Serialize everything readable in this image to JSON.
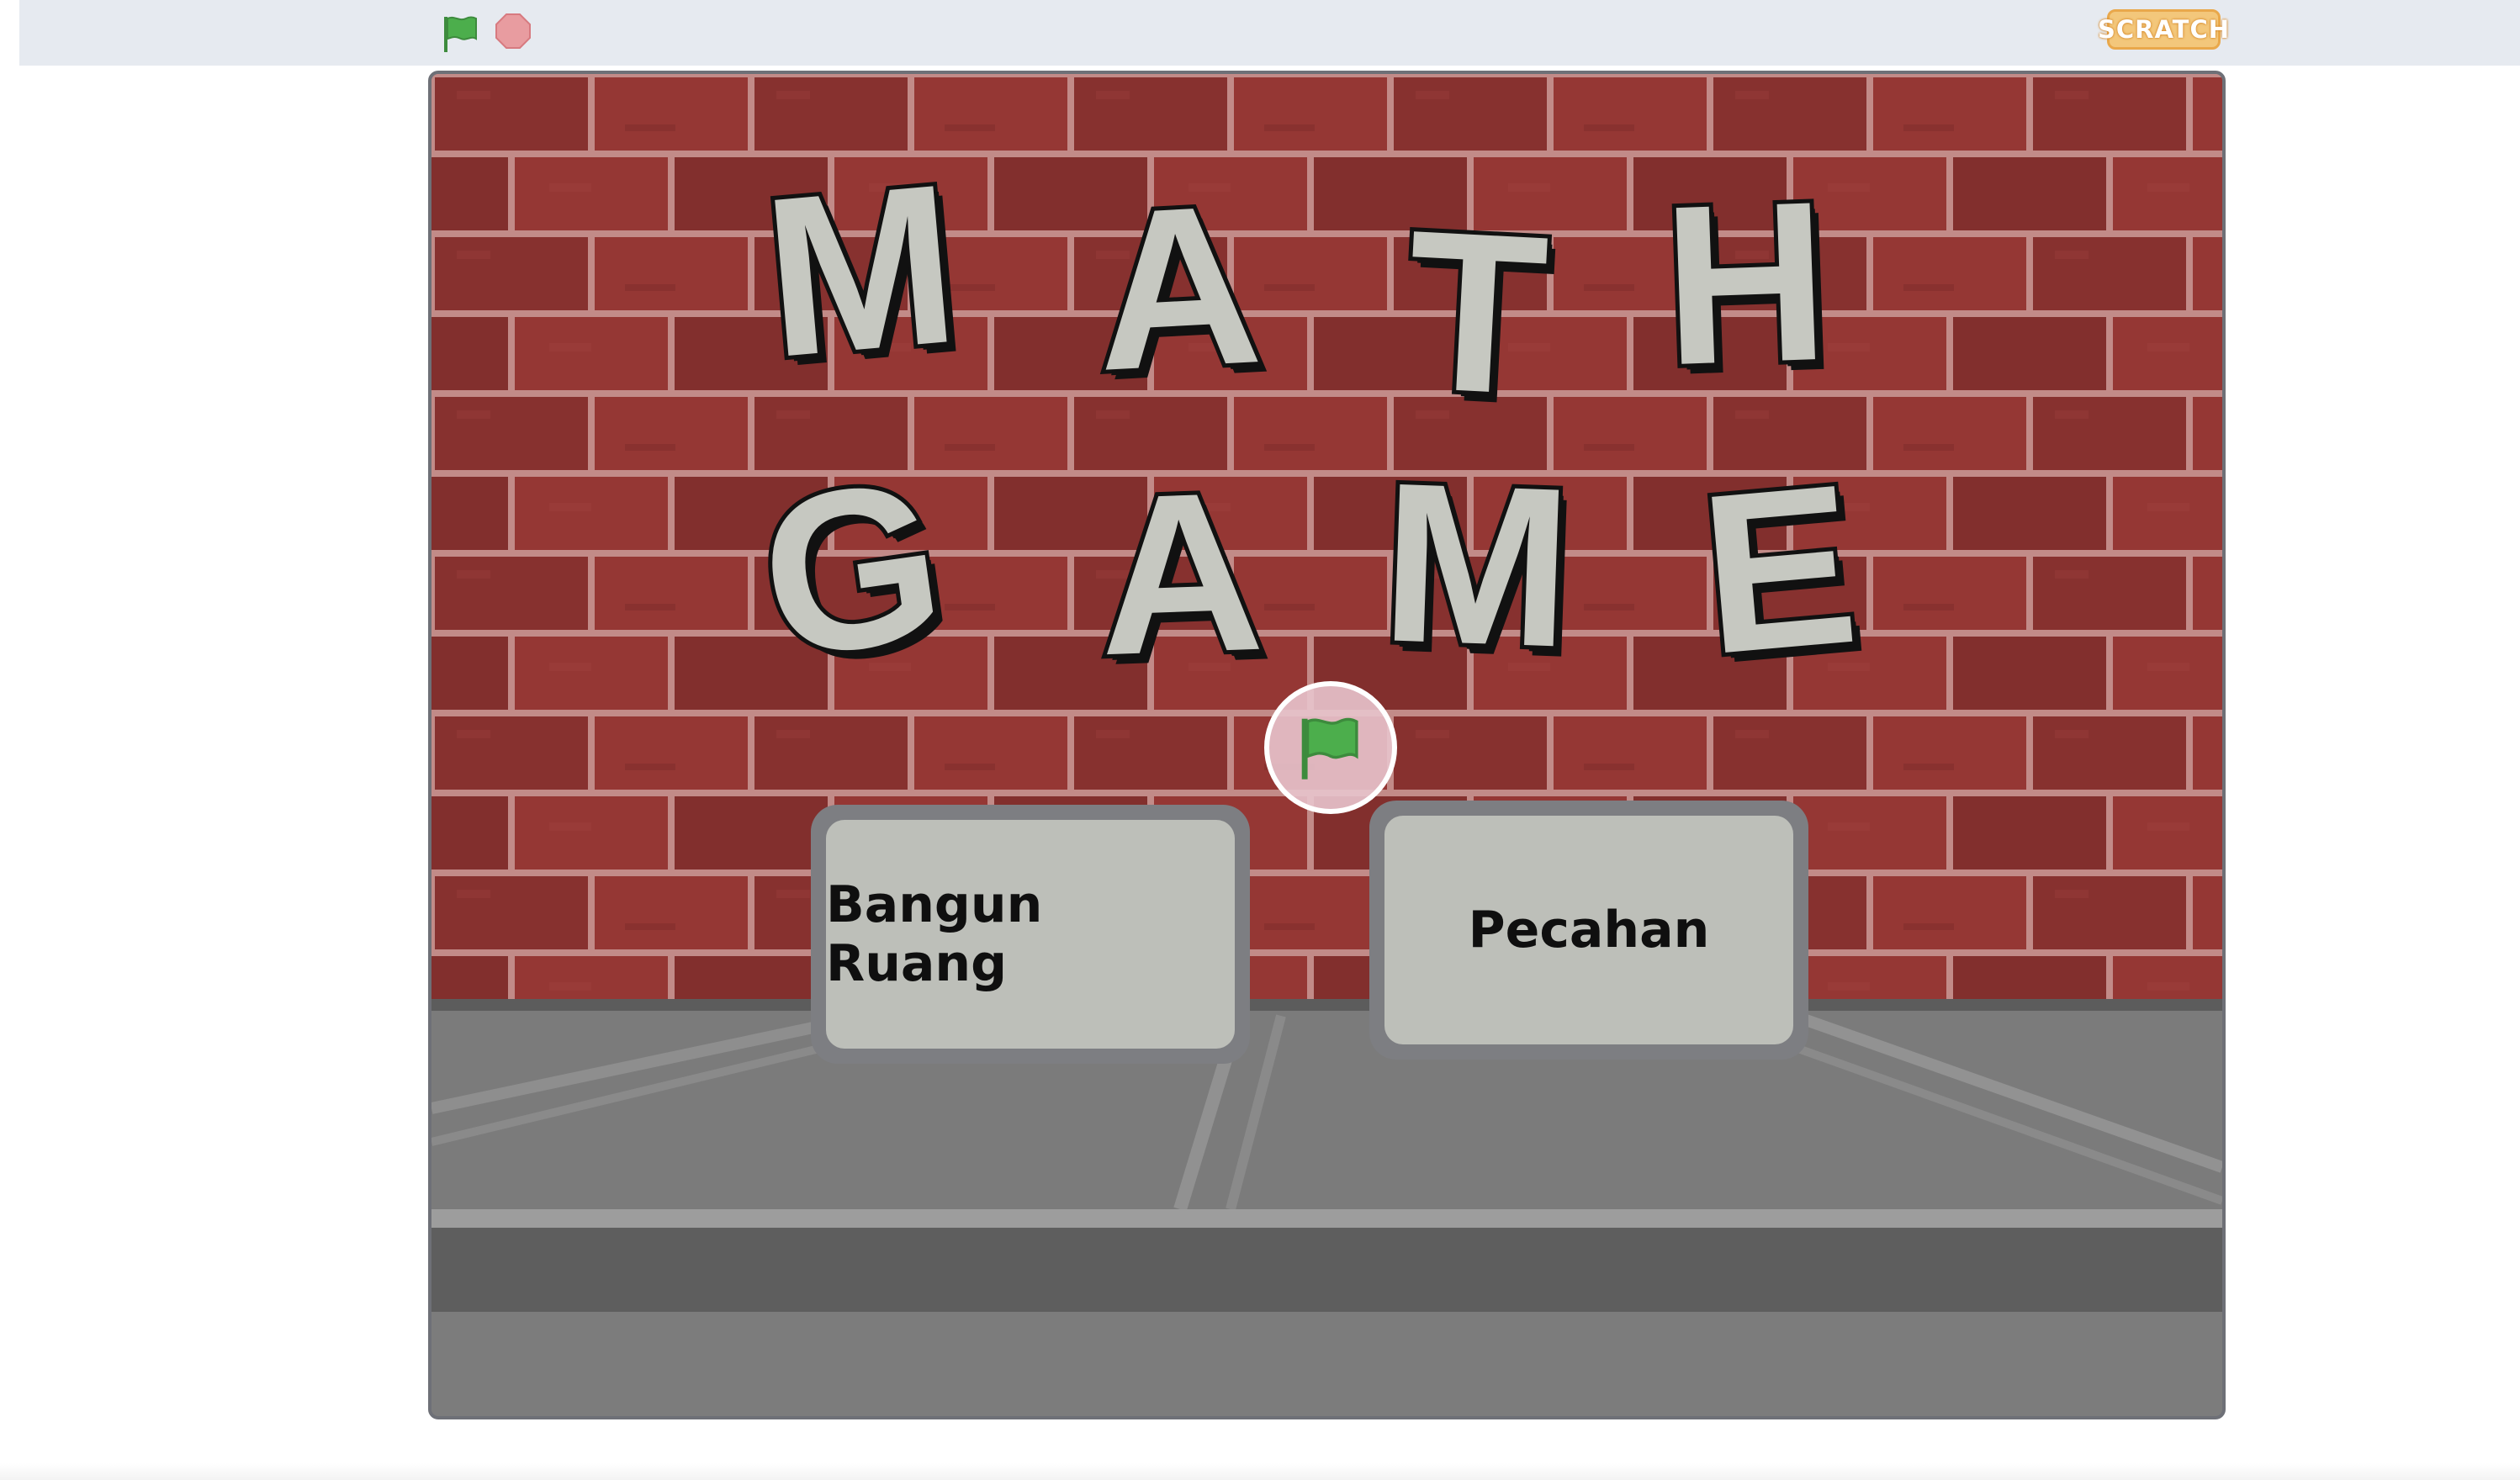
{
  "toolbar": {
    "green_flag_icon": "green-flag-icon",
    "stop_icon": "stop-sign-icon",
    "brand_logo_text": "SCRATCH"
  },
  "stage": {
    "title_line_1": [
      "M",
      "A",
      "T",
      "H"
    ],
    "title_line_2": [
      "G",
      "A",
      "M",
      "E"
    ],
    "buttons": [
      {
        "label": "Bangun Ruang"
      },
      {
        "label": "Pecahan"
      }
    ],
    "overlay_icon": "green-flag-icon"
  },
  "colors": {
    "toolbar_bg": "#e6eaf0",
    "brick": "#8b3230",
    "mortar": "#c88f8c",
    "letter_fill": "#c6c8c1",
    "button_face": "#bdbfb9",
    "button_frame": "#7d7e82",
    "flag_green": "#4cae4c",
    "stop_red": "#e89ca0"
  }
}
